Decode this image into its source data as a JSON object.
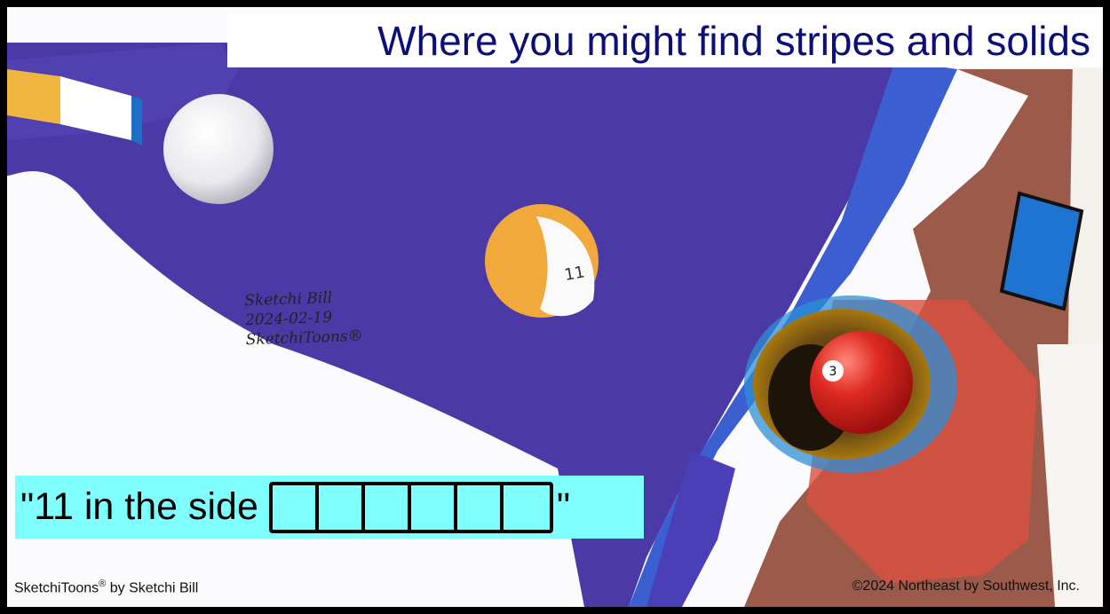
{
  "title": "Where you might find stripes and solids",
  "caption": {
    "quote_open": "\"11 in the side",
    "quote_close": "\"",
    "blank_count": 6
  },
  "footer": {
    "left_brand": "SketchiToons",
    "left_mark": "®",
    "left_suffix": " by Sketchi Bill",
    "right": "©2024 Northeast by Southwest, Inc."
  },
  "signature": {
    "line1": "Sketchi Bill",
    "line2": "2024-02-19",
    "line3": "SketchiToons®"
  },
  "balls": [
    {
      "label": "11",
      "kind": "stripe",
      "color": "#f2a93b"
    },
    {
      "label": "3",
      "kind": "solid",
      "color": "#d9231f"
    },
    {
      "label": "",
      "kind": "cue",
      "color": "#f4f4f4"
    }
  ],
  "colors": {
    "felt": "#4b3aa6",
    "rail": "#3b5fd0",
    "wood": "#9c5a4a",
    "title_text": "#0d0f78",
    "caption_bg": "#80ffff",
    "chalk": "#1e74d0"
  },
  "icons": [
    "pool-cue-icon",
    "chalk-cube-icon",
    "corner-pocket-icon"
  ]
}
